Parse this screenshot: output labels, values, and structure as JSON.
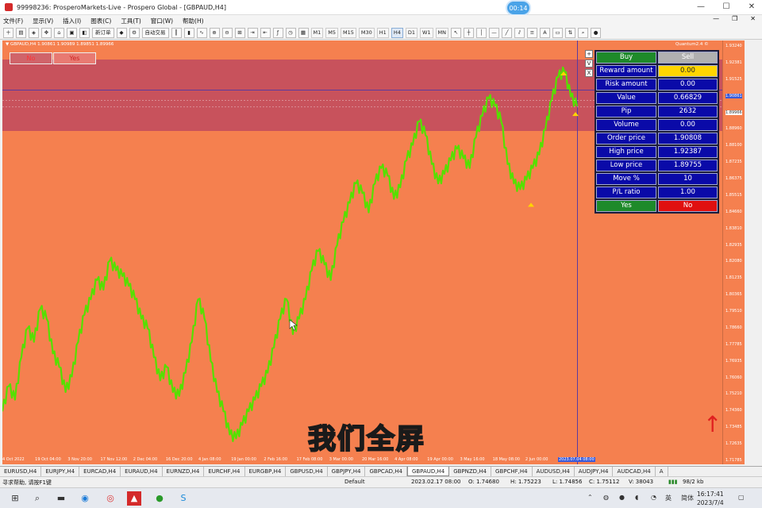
{
  "window": {
    "title": "99998236: ProsperoMarkets-Live - Prospero Global - [GBPAUD,H4]",
    "rec_time": "00:14"
  },
  "menu": [
    "文件(F)",
    "显示(V)",
    "插入(I)",
    "图表(C)",
    "工具(T)",
    "窗口(W)",
    "帮助(H)"
  ],
  "toolbar": {
    "new_order": "新订单",
    "auto_trade": "自动交易",
    "timeframes": [
      "M1",
      "M5",
      "M15",
      "M30",
      "H1",
      "H4",
      "D1",
      "W1",
      "MN"
    ],
    "active_timeframe": "H4"
  },
  "chart": {
    "label": "▼ GBPAUD,H4  1.90861 1.90989 1.89851 1.89966",
    "quantum": "Quantum2.4 ©",
    "no_button": "No",
    "yes_button": "Yes",
    "price_labels": [
      "1.93240",
      "1.92381",
      "1.91525",
      "1.90861",
      "1.89966",
      "1.88960",
      "1.88100",
      "1.87235",
      "1.86375",
      "1.85515",
      "1.84660",
      "1.83810",
      "1.82935",
      "1.82080",
      "1.81235",
      "1.80365",
      "1.79510",
      "1.78660",
      "1.77785",
      "1.76935",
      "1.76060",
      "1.75210",
      "1.74360",
      "1.73485",
      "1.72635",
      "1.71785"
    ],
    "time_labels": [
      "4 Oct 2022",
      "19 Oct 04:00",
      "3 Nov 20:00",
      "17 Nov 12:00",
      "2 Dec 04:00",
      "16 Dec 20:00",
      "4 Jan 08:00",
      "19 Jan 00:00",
      "2 Feb 16:00",
      "17 Feb 08:00",
      "3 Mar 00:00",
      "20 Mar 16:00",
      "4 Apr 08:00",
      "19 Apr 00:00",
      "3 May 16:00",
      "18 May 08:00",
      "2 Jun 00:00",
      "16 Jun",
      "2023.07.04 08:00"
    ],
    "price_series": [
      1.742,
      1.755,
      1.748,
      1.77,
      1.785,
      1.778,
      1.795,
      1.79,
      1.772,
      1.765,
      1.752,
      1.76,
      1.778,
      1.792,
      1.8,
      1.81,
      1.805,
      1.82,
      1.815,
      1.812,
      1.807,
      1.8,
      1.79,
      1.785,
      1.77,
      1.758,
      1.765,
      1.752,
      1.75,
      1.762,
      1.778,
      1.8,
      1.79,
      1.768,
      1.752,
      1.742,
      1.73,
      1.728,
      1.735,
      1.742,
      1.748,
      1.755,
      1.762,
      1.775,
      1.79,
      1.8,
      1.782,
      1.79,
      1.8,
      1.815,
      1.825,
      1.818,
      1.81,
      1.828,
      1.84,
      1.85,
      1.86,
      1.855,
      1.845,
      1.86,
      1.868,
      1.864,
      1.852,
      1.858,
      1.872,
      1.88,
      1.892,
      1.885,
      1.87,
      1.86,
      1.865,
      1.872,
      1.878,
      1.873,
      1.868,
      1.884,
      1.895,
      1.904,
      1.9,
      1.892,
      1.87,
      1.86,
      1.857,
      1.862,
      1.868,
      1.875,
      1.888,
      1.903,
      1.915,
      1.918,
      1.905,
      1.9
    ]
  },
  "trade_panel": {
    "buy_label": "Buy",
    "sell_label": "Sell",
    "rows": [
      {
        "label": "Reward amount",
        "value": "0.00",
        "highlight": true
      },
      {
        "label": "Risk amount",
        "value": "0.00"
      },
      {
        "label": "Value",
        "value": "0.66829"
      },
      {
        "label": "Pip",
        "value": "2632"
      },
      {
        "label": "Volume",
        "value": "0.00"
      },
      {
        "label": "Order price",
        "value": "1.90808"
      },
      {
        "label": "High price",
        "value": "1.92387"
      },
      {
        "label": "Low price",
        "value": "1.89755"
      },
      {
        "label": "Move %",
        "value": "10"
      },
      {
        "label": "P/L ratio",
        "value": "1.00"
      }
    ],
    "yes_label": "Yes",
    "no_label": "No",
    "side_controls": [
      "+",
      "V",
      "X"
    ]
  },
  "subtitle": "我们全屏",
  "symbol_tabs": [
    "EURUSD,H4",
    "EURJPY,H4",
    "EURCAD,H4",
    "EURAUD,H4",
    "EURNZD,H4",
    "EURCHF,H4",
    "EURGBP,H4",
    "GBPUSD,H4",
    "GBPJPY,H4",
    "GBPCAD,H4",
    "GBPAUD,H4",
    "GBPNZD,H4",
    "GBPCHF,H4",
    "AUDUSD,H4",
    "AUDJPY,H4",
    "AUDCAD,H4",
    "A"
  ],
  "active_tab": "GBPAUD,H4",
  "status": {
    "help": "寻求帮助, 请按F1键",
    "profile": "Default",
    "datetime": "2023.02.17 08:00",
    "open": "O: 1.74680",
    "high": "H: 1.75223",
    "low": "L: 1.74856",
    "close": "C: 1.75112",
    "volume": "V: 38043",
    "traffic": "98/2 kb"
  },
  "taskbar": {
    "time": "16:17:41",
    "date": "2023/7/4",
    "lang": "简体"
  },
  "colors": {
    "chart_bg": "#f5804f",
    "zone": "#c8525c",
    "line": "#55e000",
    "panel_blue": "#0a0aa8",
    "gold": "#ffd500"
  }
}
